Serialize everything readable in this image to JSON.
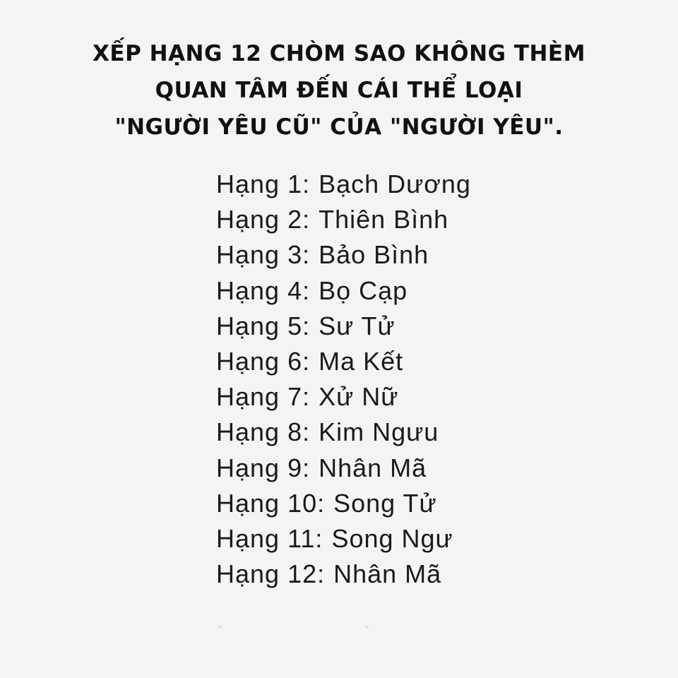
{
  "title": {
    "line1": "XẾP HẠNG 12 CHÒM SAO KHÔNG THÈM",
    "line2": "QUAN TÂM ĐẾN CÁI THỂ LOẠI",
    "line3": "\"NGƯỜI YÊU CŨ\" CỦA \"NGƯỜI YÊU\"."
  },
  "ranking": [
    {
      "label": "Hạng 1:",
      "sign": "Bạch Dương"
    },
    {
      "label": "Hạng 2:",
      "sign": "Thiên Bình"
    },
    {
      "label": "Hạng 3:",
      "sign": "Bảo Bình"
    },
    {
      "label": "Hạng 4:",
      "sign": "Bọ Cạp"
    },
    {
      "label": "Hạng 5:",
      "sign": "Sư Tử"
    },
    {
      "label": "Hạng 6:",
      "sign": "Ma Kết"
    },
    {
      "label": "Hạng 7:",
      "sign": "Xử Nữ"
    },
    {
      "label": "Hạng 8:",
      "sign": "Kim Ngưu"
    },
    {
      "label": "Hạng 9:",
      "sign": "Nhân Mã"
    },
    {
      "label": "Hạng 10:",
      "sign": "Song Tử"
    },
    {
      "label": "Hạng 11:",
      "sign": "Song Ngư"
    },
    {
      "label": "Hạng 12:",
      "sign": "Nhân Mã"
    }
  ],
  "colors": {
    "background": "#f4f4f6",
    "title_text": "#111111",
    "body_text": "#1a1a1a"
  }
}
